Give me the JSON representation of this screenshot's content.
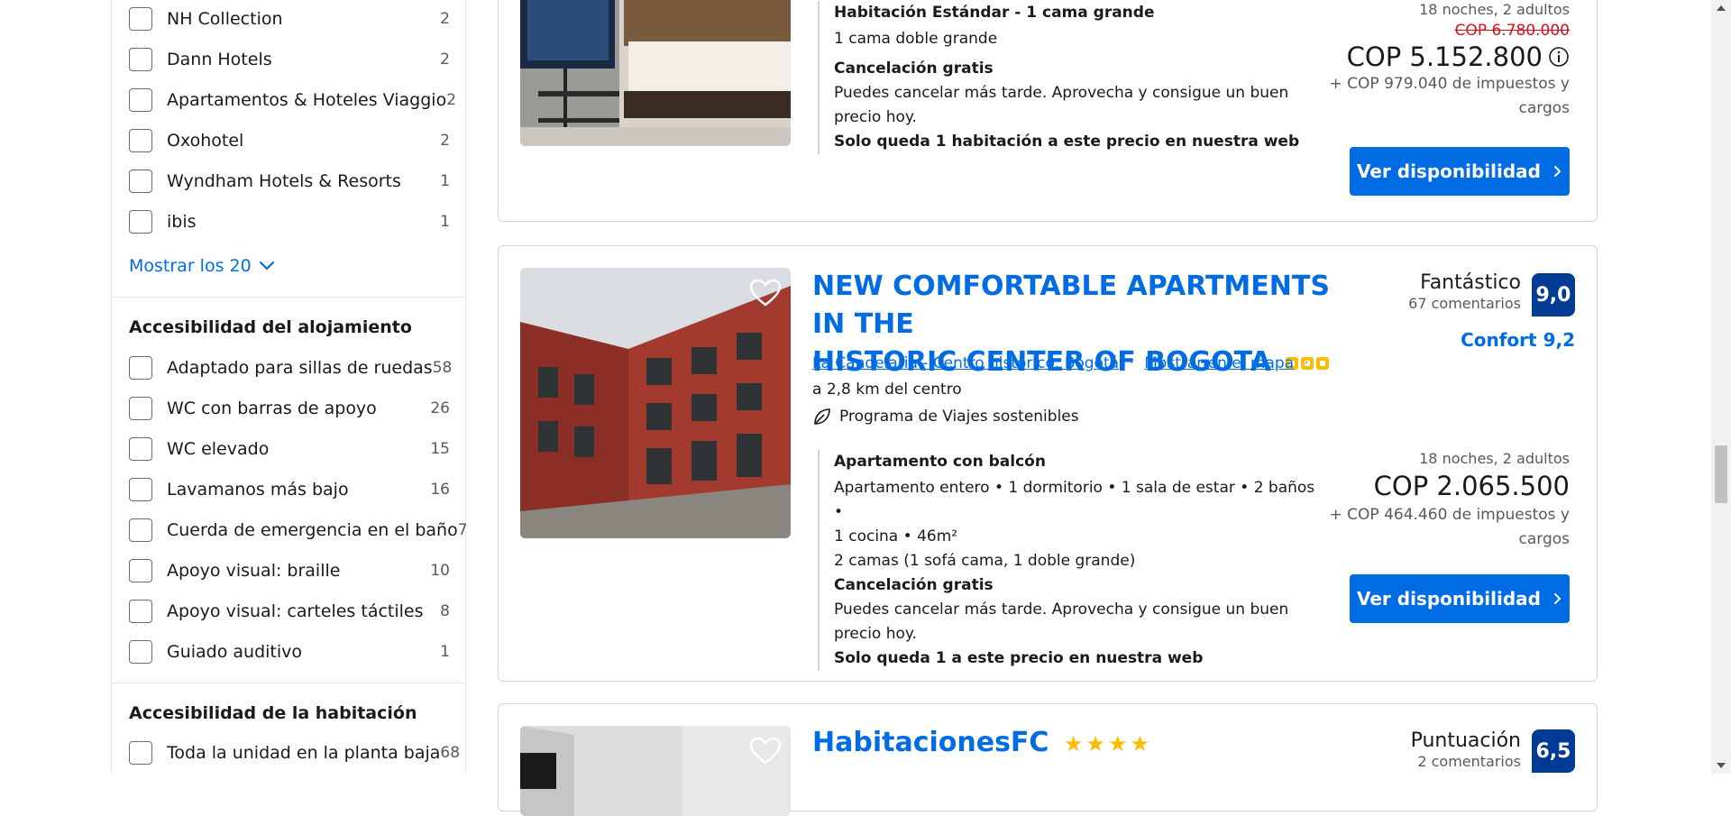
{
  "sidebar": {
    "chains": [
      {
        "label": "NH Collection",
        "count": "2"
      },
      {
        "label": "Dann Hotels",
        "count": "2"
      },
      {
        "label": "Apartamentos & Hoteles Viaggio",
        "count": "2"
      },
      {
        "label": "Oxohotel",
        "count": "2"
      },
      {
        "label": "Wyndham Hotels & Resorts",
        "count": "1"
      },
      {
        "label": "ibis",
        "count": "1"
      }
    ],
    "show_more": "Mostrar los 20",
    "accessibility_title": "Accesibilidad del alojamiento",
    "accessibility": [
      {
        "label": "Adaptado para sillas de ruedas",
        "count": "58"
      },
      {
        "label": "WC con barras de apoyo",
        "count": "26"
      },
      {
        "label": "WC elevado",
        "count": "15"
      },
      {
        "label": "Lavamanos más bajo",
        "count": "16"
      },
      {
        "label": "Cuerda de emergencia en el baño",
        "count": "7"
      },
      {
        "label": "Apoyo visual: braille",
        "count": "10"
      },
      {
        "label": "Apoyo visual: carteles táctiles",
        "count": "8"
      },
      {
        "label": "Guiado auditivo",
        "count": "1"
      }
    ],
    "room_accessibility_title": "Accesibilidad de la habitación",
    "room_accessibility": [
      {
        "label": "Toda la unidad en la planta baja",
        "count": "68"
      }
    ]
  },
  "card1": {
    "room_title": "Habitación Estándar - 1 cama grande",
    "bed": "1 cama doble grande",
    "cancel_title": "Cancelación gratis",
    "cancel_text_1": "Puedes cancelar más tarde. Aprovecha y consigue un buen",
    "cancel_text_2": "precio hoy.",
    "scarcity": "Solo queda 1 habitación a este precio en nuestra web",
    "nights": "18 noches, 2 adultos",
    "old_price": "COP 6.780.000",
    "price": "COP 5.152.800",
    "taxes_1": "+ COP 979.040 de impuestos y",
    "taxes_2": "cargos",
    "button": "Ver disponibilidad"
  },
  "card2": {
    "name_1": "NEW COMFORTABLE APARTMENTS IN THE",
    "name_2": "HISTORIC CENTER OF BOGOTA",
    "location": "La Candelaria - Centro histórico, Bogotá",
    "map_link": "Mostrar en el mapa",
    "distance": "a 2,8 km del centro",
    "sustainable": "Programa de Viajes sostenibles",
    "score_word": "Fantástico",
    "reviews": "67 comentarios",
    "score": "9,0",
    "comfort": "Confort 9,2",
    "room_title": "Apartamento con balcón",
    "details_1": "Apartamento entero • 1 dormitorio • 1 sala de estar • 2 baños •",
    "details_2": "1 cocina • 46m²",
    "beds": "2 camas (1 sofá cama, 1 doble grande)",
    "cancel_title": "Cancelación gratis",
    "cancel_text_1": "Puedes cancelar más tarde. Aprovecha y consigue un buen",
    "cancel_text_2": "precio hoy.",
    "scarcity": "Solo queda 1 a este precio en nuestra web",
    "nights": "18 noches, 2 adultos",
    "price": "COP 2.065.500",
    "taxes_1": "+ COP 464.460 de impuestos y",
    "taxes_2": "cargos",
    "button": "Ver disponibilidad"
  },
  "card3": {
    "name": "HabitacionesFC",
    "score_word": "Puntuación",
    "reviews": "2 comentarios",
    "score": "6,5"
  },
  "colors": {
    "accent": "#006ce4",
    "score_bg": "#003b95",
    "green": "#008009",
    "red": "#d4111e",
    "star": "#febb02"
  }
}
